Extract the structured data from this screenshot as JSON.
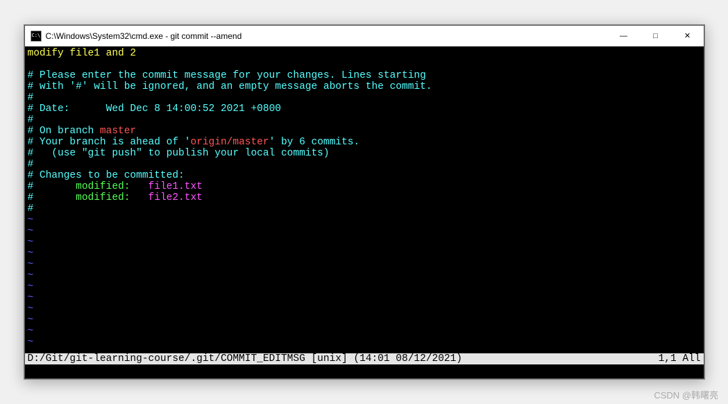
{
  "window": {
    "title": "C:\\Windows\\System32\\cmd.exe - git  commit --amend",
    "controls": {
      "minimize": "—",
      "maximize": "□",
      "close": "✕"
    }
  },
  "editor": {
    "commit_message": "modify file1 and 2",
    "hash": "#",
    "comment1": " Please enter the commit message for your changes. Lines starting",
    "comment2": " with '#' will be ignored, and an empty message aborts the commit.",
    "date_label": " Date:      ",
    "date_value": "Wed Dec 8 14:00:52 2021 +0800",
    "on_branch": " On branch ",
    "branch_name": "master",
    "ahead_pre": " Your branch is ahead of '",
    "remote": "origin/master",
    "ahead_post": "' by 6 commits.",
    "push_hint": "   (use \"git push\" to publish your local commits)",
    "changes_header": " Changes to be committed:",
    "indent": "       ",
    "modified_label": "modified:   ",
    "file1": "file1.txt",
    "file2": "file2.txt",
    "tilde": "~"
  },
  "status": {
    "left": "D:/Git/git-learning-course/.git/COMMIT_EDITMSG [unix] (14:01 08/12/2021)",
    "right": "1,1 All"
  },
  "watermark": "CSDN @韩曙亮"
}
